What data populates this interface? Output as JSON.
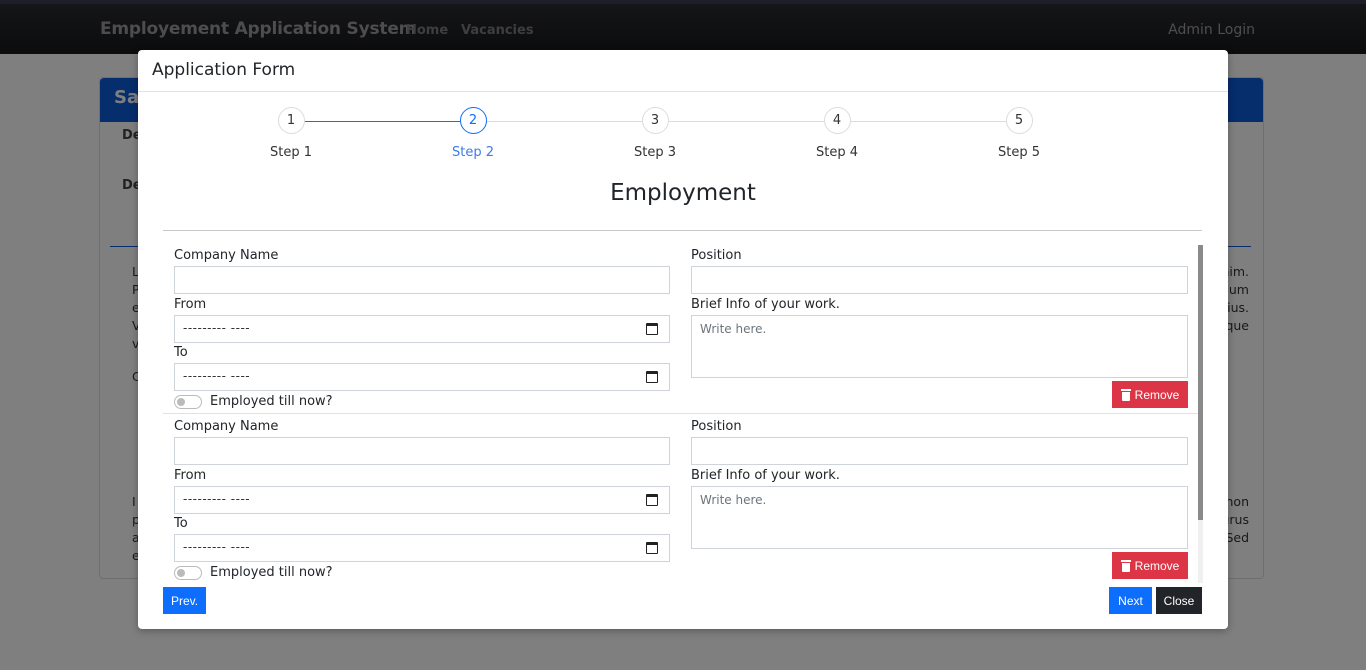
{
  "navbar": {
    "brand": "Employement Application System",
    "links": [
      "Home",
      "Vacancies"
    ],
    "admin_login": "Admin Login"
  },
  "background_card": {
    "title_fragment": "Sa",
    "label_1": "De",
    "label_2": "De",
    "left_text_lines": [
      "L",
      "P",
      "e",
      "V",
      "v"
    ],
    "left_text_2": "C",
    "left_text_3_lines": [
      "I",
      "p",
      "a",
      "e"
    ],
    "right_text_lines": [
      "nim.",
      "dum",
      "rius.",
      "eque"
    ],
    "right_text_2_lines": [
      "non",
      "urus",
      "Sed"
    ]
  },
  "modal": {
    "title": "Application Form",
    "steps": [
      {
        "number": "1",
        "label": "Step 1",
        "state": "done"
      },
      {
        "number": "2",
        "label": "Step 2",
        "state": "active"
      },
      {
        "number": "3",
        "label": "Step 3",
        "state": "pending"
      },
      {
        "number": "4",
        "label": "Step 4",
        "state": "pending"
      },
      {
        "number": "5",
        "label": "Step 5",
        "state": "pending"
      }
    ],
    "section_title": "Employment",
    "entries": [
      {
        "company_label": "Company Name",
        "company_value": "",
        "from_label": "From",
        "from_value": "--------- ----",
        "to_label": "To",
        "to_value": "--------- ----",
        "employed_label": "Employed till now?",
        "employed_checked": false,
        "position_label": "Position",
        "position_value": "",
        "info_label": "Brief Info of your work.",
        "info_placeholder": "Write here.",
        "remove_label": "Remove"
      },
      {
        "company_label": "Company Name",
        "company_value": "",
        "from_label": "From",
        "from_value": "--------- ----",
        "to_label": "To",
        "to_value": "--------- ----",
        "employed_label": "Employed till now?",
        "employed_checked": false,
        "position_label": "Position",
        "position_value": "",
        "info_label": "Brief Info of your work.",
        "info_placeholder": "Write here.",
        "remove_label": "Remove"
      }
    ],
    "buttons": {
      "prev": "Prev.",
      "next": "Next",
      "close": "Close"
    }
  },
  "colors": {
    "primary": "#0d6efd",
    "danger": "#dc3545",
    "dark": "#212529",
    "card_header": "#0d5bd8"
  }
}
